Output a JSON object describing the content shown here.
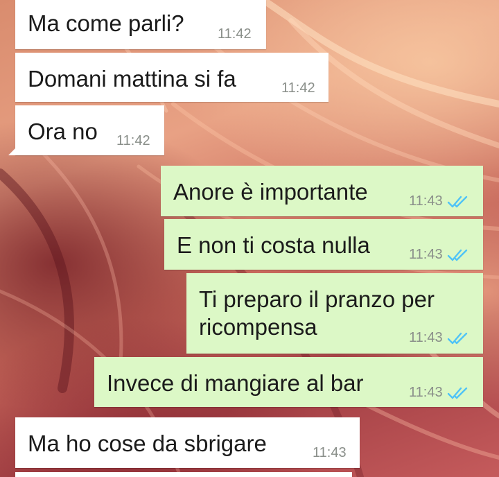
{
  "colors": {
    "incoming_bubble": "#ffffff",
    "outgoing_bubble": "#dcf8c6",
    "read_ticks": "#4fc3f7",
    "timestamp": "#8a8f8a"
  },
  "messages": [
    {
      "direction": "incoming",
      "text": "Ma come parli?",
      "time": "11:42"
    },
    {
      "direction": "incoming",
      "text": "Domani mattina si fa",
      "time": "11:42"
    },
    {
      "direction": "incoming",
      "text": "Ora no",
      "time": "11:42"
    },
    {
      "direction": "outgoing",
      "text": "Anore è importante",
      "time": "11:43",
      "status_icon": "double-check-icon"
    },
    {
      "direction": "outgoing",
      "text": "E non ti costa nulla",
      "time": "11:43",
      "status_icon": "double-check-icon"
    },
    {
      "direction": "outgoing",
      "text_lines": [
        "Ti preparo il pranzo per",
        "ricompensa"
      ],
      "time": "11:43",
      "status_icon": "double-check-icon"
    },
    {
      "direction": "outgoing",
      "text": "Invece di mangiare al bar",
      "time": "11:43",
      "status_icon": "double-check-icon"
    },
    {
      "direction": "incoming",
      "text": "Ma ho cose da sbrigare",
      "time": "11:43"
    }
  ]
}
